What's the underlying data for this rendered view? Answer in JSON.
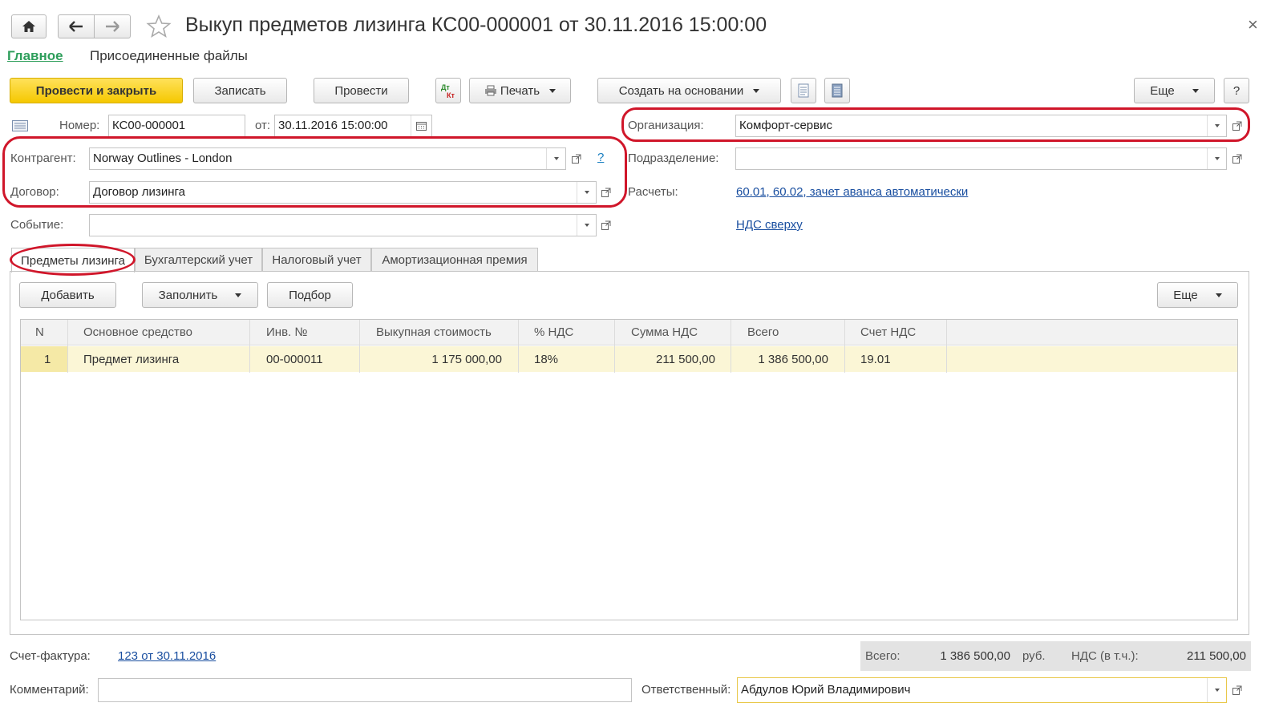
{
  "window": {
    "title": "Выкуп предметов лизинга КС00-000001 от 30.11.2016 15:00:00",
    "close_glyph": "×"
  },
  "nav": {
    "main_link": "Главное",
    "attached_files": "Присоединенные файлы"
  },
  "toolbar": {
    "post_close": "Провести и закрыть",
    "save": "Записать",
    "post": "Провести",
    "dtkt_icon": "dt-kt-icon",
    "print": "Печать",
    "create_based": "Создать на основании",
    "more": "Еще",
    "help": "?"
  },
  "header": {
    "number_label": "Номер:",
    "number_value": "КС00-000001",
    "date_label": "от:",
    "date_value": "30.11.2016 15:00:00",
    "org_label": "Организация:",
    "org_value": "Комфорт-сервис",
    "contractor_label": "Контрагент:",
    "contractor_value": "Norway Outlines - London",
    "contractor_help": "?",
    "division_label": "Подразделение:",
    "division_value": "",
    "contract_label": "Договор:",
    "contract_value": "Договор лизинга",
    "settlements_label": "Расчеты:",
    "settlements_link": "60.01, 60.02, зачет аванса автоматически",
    "event_label": "Событие:",
    "event_value": "",
    "vat_link": "НДС сверху"
  },
  "tabs": [
    {
      "label": "Предметы лизинга",
      "active": true
    },
    {
      "label": "Бухгалтерский учет",
      "active": false
    },
    {
      "label": "Налоговый учет",
      "active": false
    },
    {
      "label": "Амортизационная премия",
      "active": false
    }
  ],
  "table_toolbar": {
    "add": "Добавить",
    "fill": "Заполнить",
    "select": "Подбор",
    "more": "Еще"
  },
  "table": {
    "columns": [
      "N",
      "Основное средство",
      "Инв. №",
      "Выкупная стоимость",
      "% НДС",
      "Сумма НДС",
      "Всего",
      "Счет НДС"
    ],
    "rows": [
      [
        "1",
        "Предмет лизинга",
        "00-000011",
        "1 175 000,00",
        "18%",
        "211 500,00",
        "1 386 500,00",
        "19.01"
      ]
    ]
  },
  "footer": {
    "invoice_label": "Счет-фактура:",
    "invoice_link": "123 от 30.11.2016",
    "total_label": "Всего:",
    "total_value": "1 386 500,00",
    "currency": "руб.",
    "vat_label": "НДС (в т.ч.):",
    "vat_value": "211 500,00",
    "comment_label": "Комментарий:",
    "comment_value": "",
    "responsible_label": "Ответственный:",
    "responsible_value": "Абдулов Юрий Владимирович"
  },
  "colors": {
    "primary_button": "#f5c800",
    "link": "#1a4fa0",
    "nav_active": "#2e9e5b",
    "highlight_oval": "#d0162a",
    "selected_row": "#fbf6d6"
  }
}
